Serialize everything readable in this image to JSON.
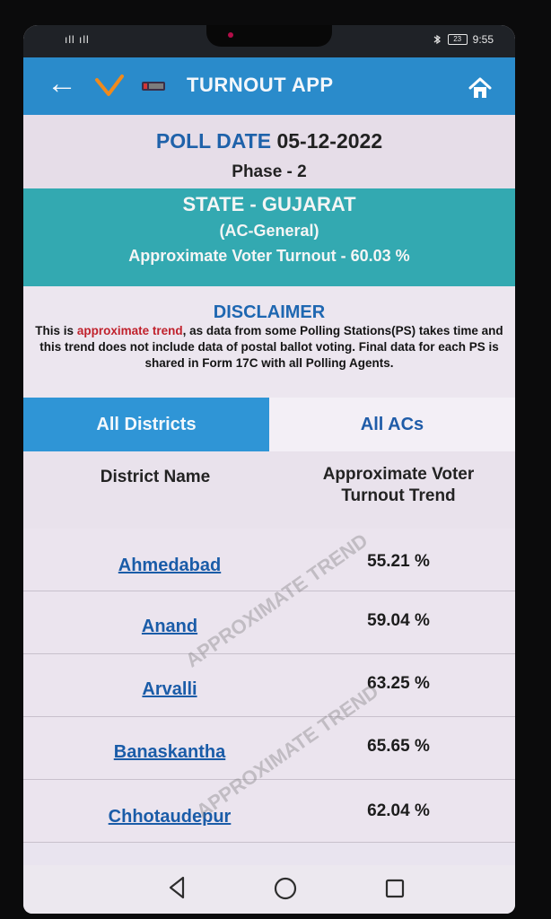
{
  "status_bar": {
    "left": "ıll ıll",
    "battery": "23",
    "time": "9:55"
  },
  "app_bar": {
    "title": "TURNOUT APP"
  },
  "poll": {
    "date_label": "POLL DATE",
    "date_value": "05-12-2022",
    "phase": "Phase - 2"
  },
  "state_info": {
    "state": "STATE - GUJARAT",
    "ac_type": "(AC-General)",
    "turnout_summary": "Approximate Voter Turnout - 60.03 %"
  },
  "disclaimer": {
    "title": "DISCLAIMER",
    "text_before": "This is ",
    "highlight": "approximate trend",
    "text_after": ", as data from some Polling Stations(PS) takes time and this trend does not include data of postal ballot voting. Final data for each PS is shared in Form 17C with all Polling Agents."
  },
  "tabs": [
    {
      "label": "All Districts",
      "active": true
    },
    {
      "label": "All ACs",
      "active": false
    }
  ],
  "table": {
    "header_left": "District Name",
    "header_right": "Approximate Voter Turnout Trend",
    "rows": [
      {
        "district": "Ahmedabad",
        "turnout": "55.21 %"
      },
      {
        "district": "Anand",
        "turnout": "59.04 %"
      },
      {
        "district": "Arvalli",
        "turnout": "63.25 %"
      },
      {
        "district": "Banaskantha",
        "turnout": "65.65 %"
      },
      {
        "district": "Chhotaudepur",
        "turnout": "62.04 %"
      }
    ]
  },
  "watermark": {
    "text": "APPROXIMATE TREND"
  },
  "colors": {
    "app_bar": "#2a8bcb",
    "state_bar": "#33a9b1",
    "active_tab": "#2f95d6",
    "link": "#1a5ca8",
    "highlight": "#c0212c"
  }
}
